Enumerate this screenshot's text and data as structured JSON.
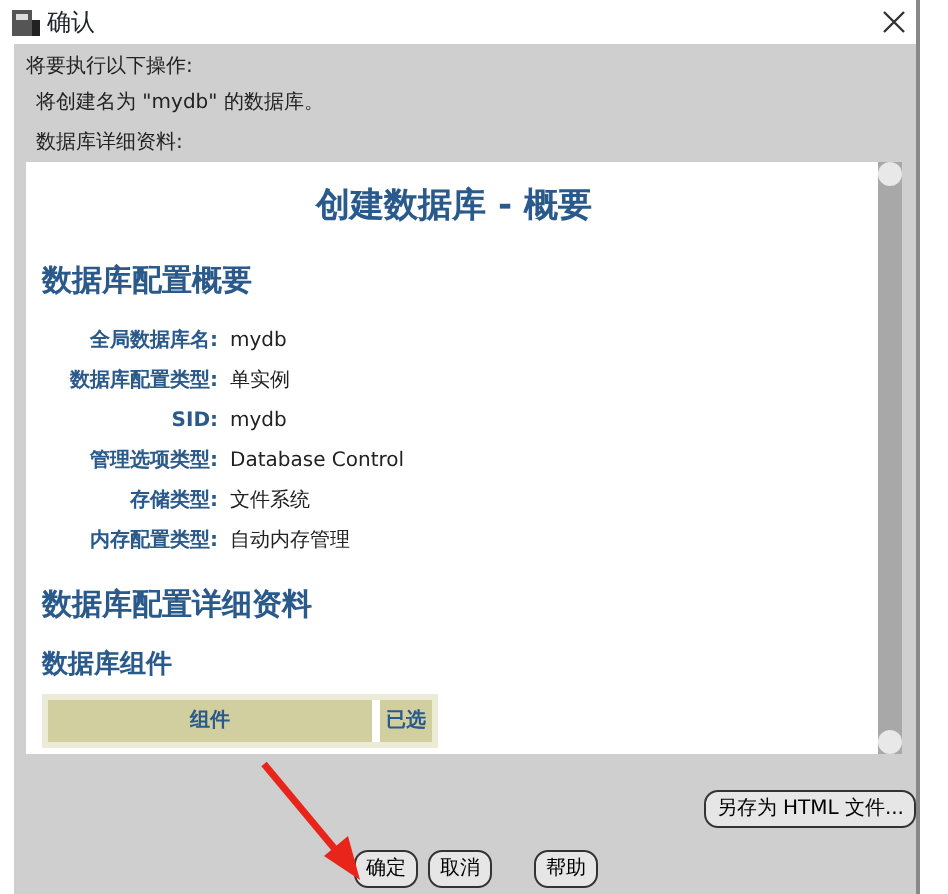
{
  "window": {
    "title": "确认"
  },
  "intro": [
    "将要执行以下操作:",
    "将创建名为 \"mydb\" 的数据库。"
  ],
  "details_label": "数据库详细资料:",
  "report": {
    "title": "创建数据库 - 概要",
    "section": "数据库配置概要",
    "fields": [
      {
        "label": "全局数据库名:",
        "value": "mydb"
      },
      {
        "label": "数据库配置类型:",
        "value": "单实例"
      },
      {
        "label": "SID:",
        "value": "mydb"
      },
      {
        "label": "管理选项类型:",
        "value": "Database Control"
      },
      {
        "label": "存储类型:",
        "value": "文件系统"
      },
      {
        "label": "内存配置类型:",
        "value": "自动内存管理"
      }
    ],
    "section_2": "数据库配置详细资料",
    "subsection": "数据库组件",
    "table": {
      "columns": [
        "组件",
        "已选"
      ]
    }
  },
  "save_button": "另存为 HTML 文件...",
  "buttons": [
    "确定",
    "取消",
    "帮助"
  ]
}
